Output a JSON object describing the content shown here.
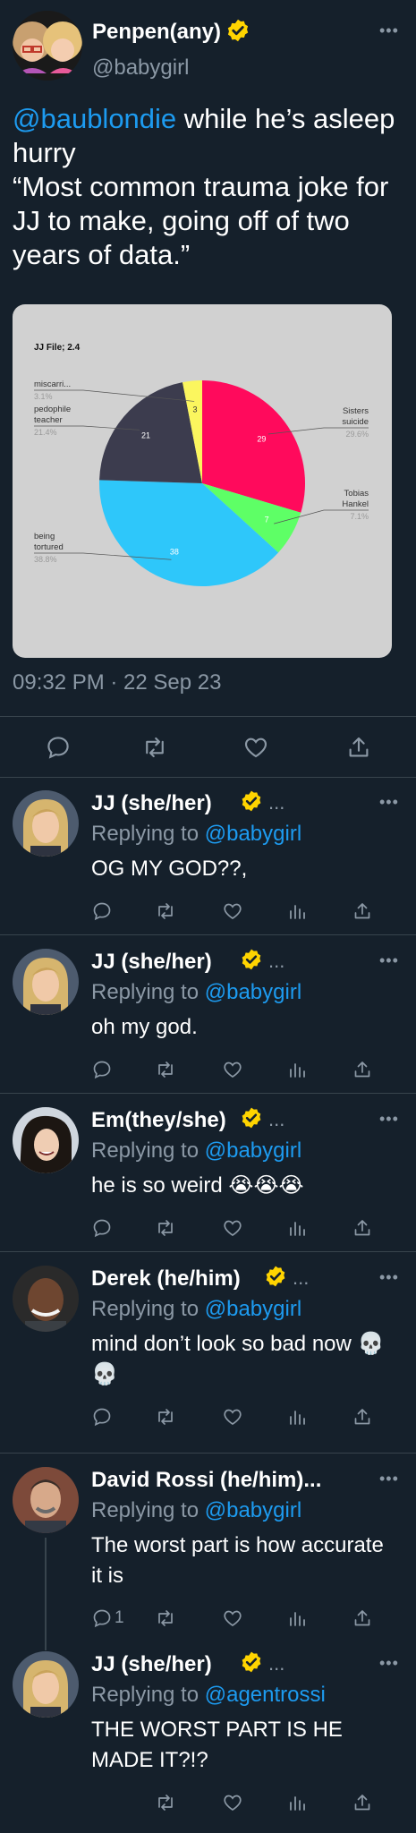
{
  "main_tweet": {
    "display_name": "Penpen(any)",
    "handle": "@babygirl",
    "mention": "@baublondie",
    "text_after_mention": " while he’s asleep hurry",
    "quote_line": "“Most common trauma joke for JJ to make, going off of two years of data.”",
    "timestamp": "09:32 PM · 22 Sep 23"
  },
  "chart_data": {
    "type": "pie",
    "title": "JJ File; 2.4",
    "slices": [
      {
        "label": "Sisters suicide",
        "value": 29,
        "percent": "29.6%",
        "color": "#ff0a5c"
      },
      {
        "label": "Tobias Hankel",
        "value": 7,
        "percent": "7.1%",
        "color": "#5eff66"
      },
      {
        "label": "being tortured",
        "value": 38,
        "percent": "38.8%",
        "color": "#2ec7fa"
      },
      {
        "label": "pedophile teacher",
        "value": 21,
        "percent": "21.4%",
        "color": "#3c3c4e"
      },
      {
        "label": "miscarri...",
        "value": 3,
        "percent": "3.1%",
        "color": "#fbf65e"
      }
    ],
    "value_labels": [
      "29",
      "7",
      "38",
      "21",
      "3"
    ]
  },
  "replies": [
    {
      "name": "JJ (she/her)",
      "replying_label": "Replying to",
      "replying_handle": "@babygirl",
      "text": "OG MY GOD??,",
      "reply_count": ""
    },
    {
      "name": "JJ (she/her)",
      "replying_label": "Replying to",
      "replying_handle": "@babygirl",
      "text": "oh my god.",
      "reply_count": ""
    },
    {
      "name": "Em(they/she)",
      "replying_label": "Replying to",
      "replying_handle": "@babygirl",
      "text": "he is so weird 😭😭😭",
      "reply_count": ""
    },
    {
      "name": "Derek (he/him)",
      "replying_label": "Replying to",
      "replying_handle": "@babygirl",
      "text": "mind don’t look so bad now 💀💀",
      "reply_count": ""
    },
    {
      "name": "David Rossi (he/him)...",
      "replying_label": "Replying to",
      "replying_handle": "@babygirl",
      "text": "The worst part is how accurate it is",
      "reply_count": "1"
    },
    {
      "name": "JJ (she/her)",
      "replying_label": "Replying to",
      "replying_handle": "@agentrossi",
      "text": "THE WORST PART IS HE MADE IT?!?",
      "reply_count": ""
    }
  ],
  "icons": [
    "reply-icon",
    "retweet-icon",
    "like-icon",
    "views-icon",
    "share-icon",
    "verified-badge-icon",
    "more-icon"
  ],
  "colors": {
    "background": "#15202b",
    "accent": "#1d9bf0",
    "muted": "#8b98a5",
    "verified": "#ffd400"
  }
}
